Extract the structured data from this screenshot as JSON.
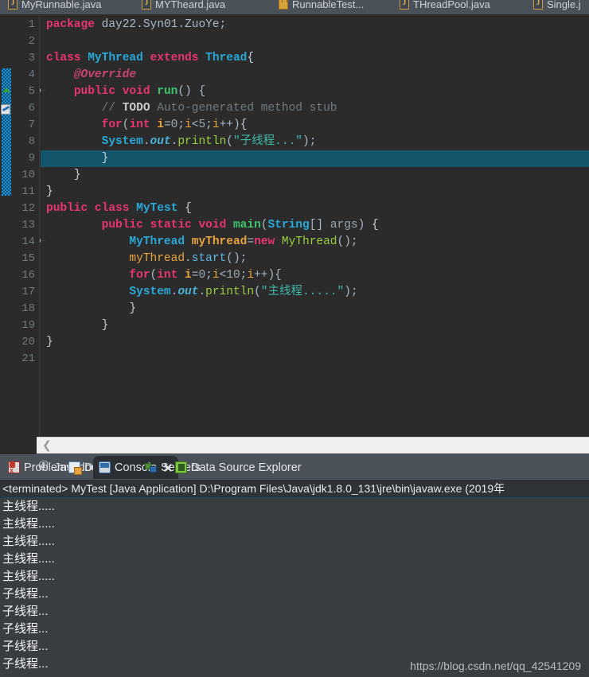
{
  "editor_tabs": [
    {
      "label": "MyRunnable.java",
      "icon": "java-file-icon",
      "active": false
    },
    {
      "label": "MYTheard.java",
      "icon": "java-file-icon",
      "active": false
    },
    {
      "label": "RunnableTest...",
      "icon": "locked-file-icon",
      "active": false
    },
    {
      "label": "THreadPool.java",
      "icon": "java-file-icon",
      "active": false
    },
    {
      "label": "Single.j",
      "icon": "java-file-icon",
      "active": false
    }
  ],
  "code": {
    "language": "java",
    "highlighted_line": 9,
    "fold_markers": [
      4,
      13
    ],
    "lines": [
      {
        "n": 1,
        "html": "<span class=\"kw\">package</span> <span class=\"punc\">day22.Syn01.ZuoYe;</span>"
      },
      {
        "n": 2,
        "html": ""
      },
      {
        "n": 3,
        "html": "<span class=\"kw\">class</span> <span class=\"type\">MyThread</span> <span class=\"kw\">extends</span> <span class=\"type\">Thread</span><span class=\"brace\">{</span>"
      },
      {
        "n": 4,
        "html": "    <span class=\"ann\">@Override</span>"
      },
      {
        "n": 5,
        "html": "    <span class=\"kw\">public</span> <span class=\"kw\">void</span> <span class=\"fn\">run</span><span class=\"punc\">() {</span>"
      },
      {
        "n": 6,
        "html": "        <span class=\"cmt\">// <b>TODO</b> Auto-generated method stub</span>"
      },
      {
        "n": 7,
        "html": "        <span class=\"kw\">for</span><span class=\"punc\">(</span><span class=\"kw\">int</span> <span class=\"var\">i</span><span class=\"punc\">=</span><span class=\"num\">0</span><span class=\"punc\">;</span><span class=\"varp\">i</span><span class=\"punc\">&lt;</span><span class=\"num\">5</span><span class=\"punc\">;</span><span class=\"varp\">i</span><span class=\"punc\">++)</span><span class=\"brace\">{</span>"
      },
      {
        "n": 8,
        "html": "        <span class=\"type\">System</span><span class=\"punc\">.</span><span class=\"fld\">out</span><span class=\"punc\">.</span><span class=\"fnp\">println</span><span class=\"punc\">(</span><span class=\"str\">\"子线程...\"</span><span class=\"punc\">);</span>"
      },
      {
        "n": 9,
        "html": "        <span class=\"brace\">}</span>"
      },
      {
        "n": 10,
        "html": "    <span class=\"brace\">}</span>"
      },
      {
        "n": 11,
        "html": "<span class=\"brace\">}</span>"
      },
      {
        "n": 12,
        "html": "<span class=\"kw\">public</span> <span class=\"kw\">class</span> <span class=\"type\">MyTest</span> <span class=\"brace\">{</span>"
      },
      {
        "n": 13,
        "html": "        <span class=\"kw\">public</span> <span class=\"kw\">static</span> <span class=\"kw\">void</span> <span class=\"fn\">main</span><span class=\"punc\">(</span><span class=\"type\">String</span><span class=\"punc\">[] </span><span class=\"num\">args</span><span class=\"punc\">) </span><span class=\"brace\">{</span>"
      },
      {
        "n": 14,
        "html": "            <span class=\"type\">MyThread</span> <span class=\"var\">myThread</span><span class=\"punc\">=</span><span class=\"kw\">new</span> <span class=\"fnp\">MyThread</span><span class=\"punc\">();</span>"
      },
      {
        "n": 15,
        "html": "            <span class=\"varp\">myThread</span><span class=\"punc\">.</span><span class=\"typeplain\">start</span><span class=\"punc\">();</span>"
      },
      {
        "n": 16,
        "html": "            <span class=\"kw\">for</span><span class=\"punc\">(</span><span class=\"kw\">int</span> <span class=\"var\">i</span><span class=\"punc\">=</span><span class=\"num\">0</span><span class=\"punc\">;</span><span class=\"varp\">i</span><span class=\"punc\">&lt;</span><span class=\"num\">10</span><span class=\"punc\">;</span><span class=\"varp\">i</span><span class=\"punc\">++){</span>"
      },
      {
        "n": 17,
        "html": "            <span class=\"type\">System</span><span class=\"punc\">.</span><span class=\"fld\">out</span><span class=\"punc\">.</span><span class=\"fnp\">println</span><span class=\"punc\">(</span><span class=\"str\">\"主线程.....\"</span><span class=\"punc\">);</span>"
      },
      {
        "n": 18,
        "html": "            <span class=\"brace\">}</span>"
      },
      {
        "n": 19,
        "html": "        <span class=\"brace\">}</span>"
      },
      {
        "n": 20,
        "html": "<span class=\"brace\">}</span>"
      },
      {
        "n": 21,
        "html": ""
      }
    ]
  },
  "view_tabs": [
    {
      "label": "Problems",
      "icon": "problems-icon",
      "active": false,
      "closable": false
    },
    {
      "label": "Javadoc",
      "icon": "javadoc-icon",
      "active": false,
      "closable": false
    },
    {
      "label": "Declaration",
      "icon": "declaration-icon",
      "active": false,
      "closable": false
    },
    {
      "label": "Console",
      "icon": "console-icon",
      "active": true,
      "closable": true
    },
    {
      "label": "Servers",
      "icon": "servers-icon",
      "active": false,
      "closable": false
    },
    {
      "label": "Data Source Explorer",
      "icon": "data-source-explorer-icon",
      "active": false,
      "closable": false
    }
  ],
  "console": {
    "status_line": "<terminated> MyTest [Java Application] D:\\Program Files\\Java\\jdk1.8.0_131\\jre\\bin\\javaw.exe (2019年",
    "output": [
      "主线程.....",
      "主线程.....",
      "主线程.....",
      "主线程.....",
      "主线程.....",
      "子线程...",
      "子线程...",
      "子线程...",
      "子线程...",
      "子线程..."
    ]
  },
  "watermark": "https://blog.csdn.net/qq_42541209",
  "colors": {
    "editor_bg": "#2b2b2b",
    "chrome_bg": "#4a5159",
    "console_bg": "#3a3d40",
    "highlight_line": "#14566b",
    "keyword": "#e8356d",
    "type": "#29a8d8",
    "string": "#3fb8a8",
    "comment": "#6f7a80"
  }
}
